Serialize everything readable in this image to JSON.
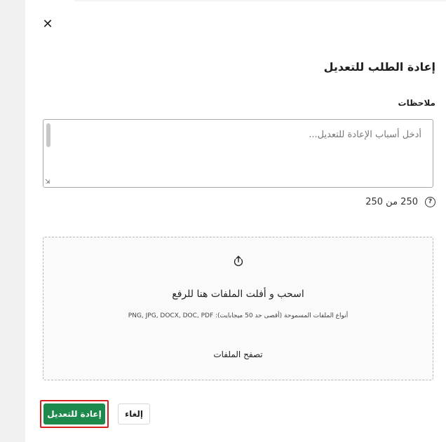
{
  "dialog": {
    "close_icon": "close-icon",
    "title": "إعادة الطلب للتعديل",
    "notes_label": "ملاحظات",
    "notes_placeholder": "أدخل أسباب الإعادة للتعديل...",
    "counter_text": "250 من 250",
    "help_icon_glyph": "?",
    "dropzone": {
      "upload_icon": "upload-icon",
      "title": "اسحب و أفلت الملفات هنا للرفع",
      "allowed_types": "أنواع الملفات المسموحة (أقصى حد 50 ميجابايت): PNG, JPG, DOCX, DOC, PDF",
      "browse_label": "تصفح الملفات"
    },
    "buttons": {
      "cancel_label": "إلغاء",
      "submit_label": "إعادة للتعديل"
    }
  },
  "colors": {
    "primary_green": "#1d8a4b",
    "highlight_red": "#d62020"
  }
}
